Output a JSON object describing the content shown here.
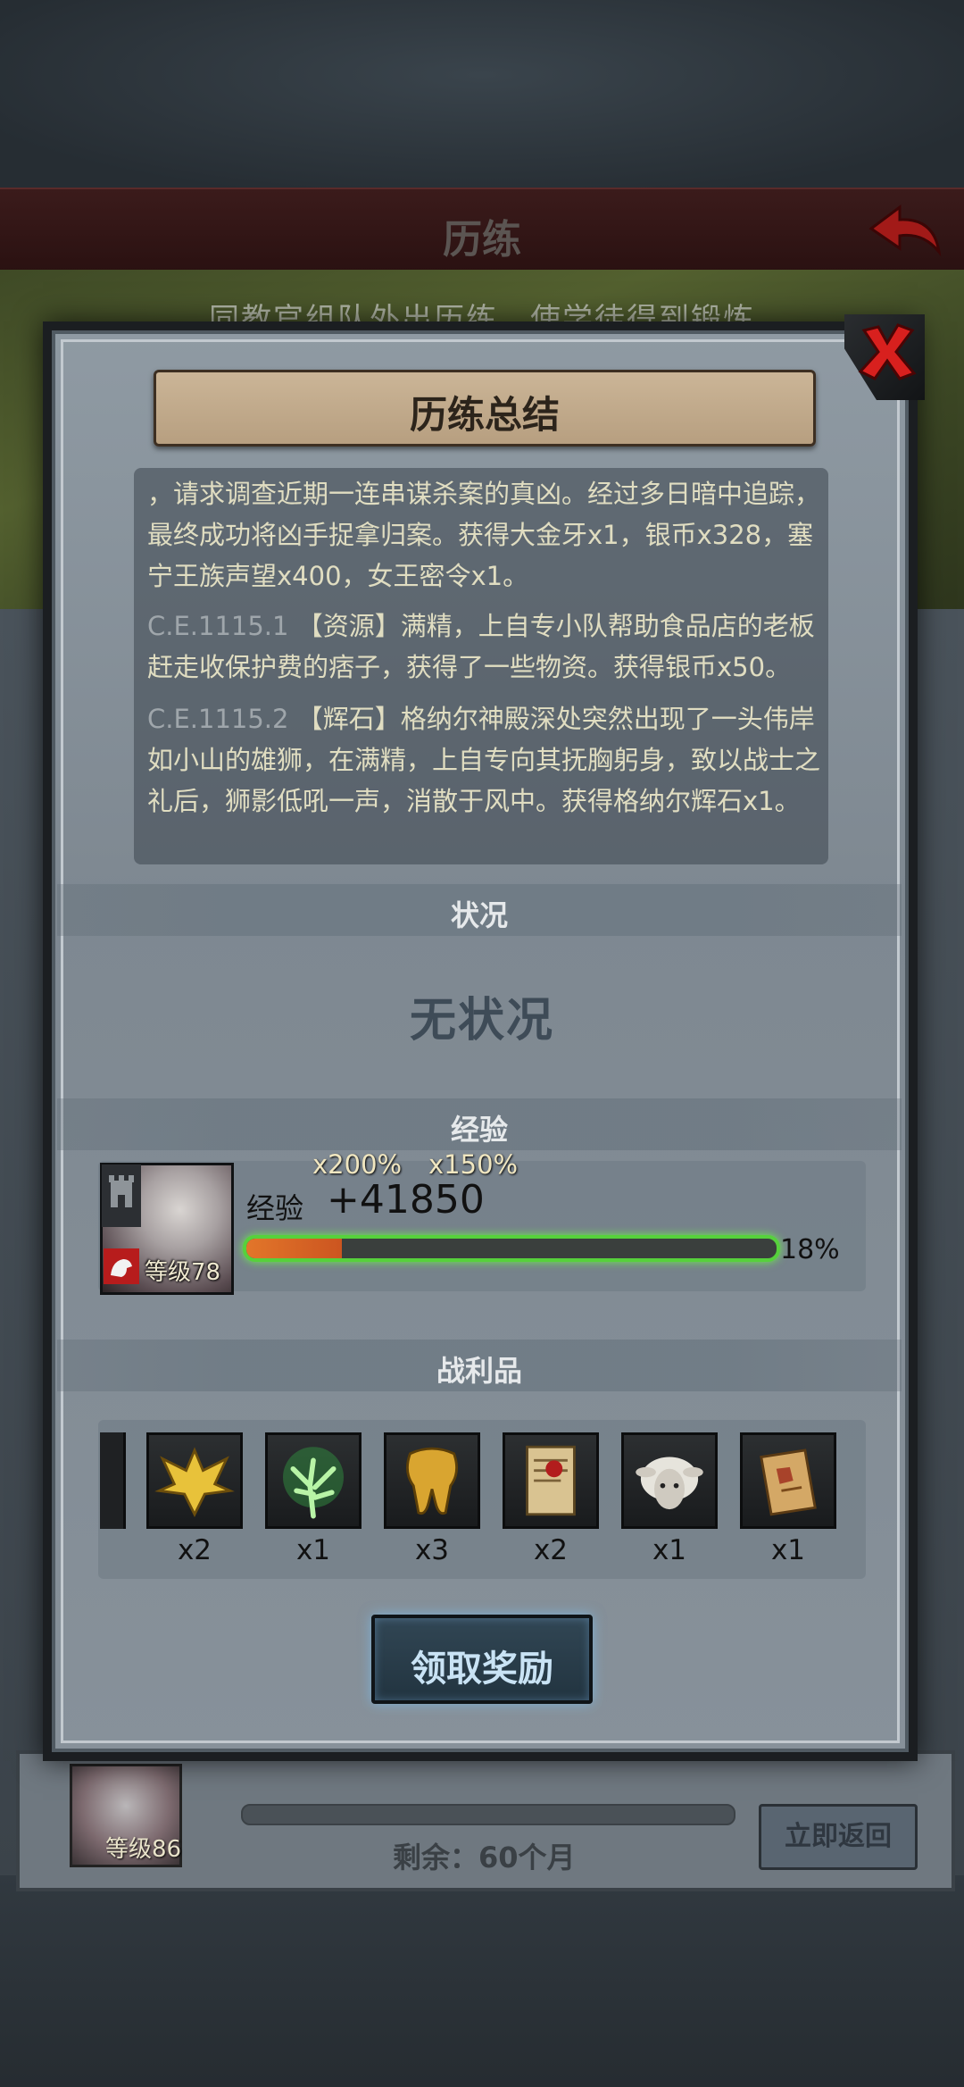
{
  "background": {
    "header_title": "历练",
    "subtitle": "同教官组队外出历练，使学徒得到锻炼",
    "footer": {
      "level": "等级86",
      "remaining": "剩余：60个月",
      "return_button": "立即返回"
    }
  },
  "dialog": {
    "title": "历练总结",
    "log": [
      {
        "date": "",
        "text": "，请求调查近期一连串谋杀案的真凶。经过多日暗中追踪，最终成功将凶手捉拿归案。获得大金牙x1，银币x328，塞宁王族声望x400，女王密令x1。"
      },
      {
        "date": "C.E.1115.1",
        "text": "【资源】满精，上自专小队帮助食品店的老板赶走收保护费的痞子，获得了一些物资。获得银币x50。"
      },
      {
        "date": "C.E.1115.2",
        "text": "【辉石】格纳尔神殿深处突然出现了一头伟岸如小山的雄狮，在满精，上自专向其抚胸躬身，致以战士之礼后，狮影低吼一声，消散于风中。获得格纳尔辉石x1。"
      }
    ],
    "status_header": "状况",
    "status_text": "无状况",
    "exp_header": "经验",
    "exp": {
      "multiplier_1": "x200%",
      "multiplier_2": "x150%",
      "label": "经验",
      "value": "+41850",
      "percent_text": "18%",
      "progress": 0.18,
      "hero_level": "等级78"
    },
    "loot_header": "战利品",
    "loot": [
      {
        "icon": "gold-crest-icon",
        "count": "x2"
      },
      {
        "icon": "green-tree-icon",
        "count": "x1"
      },
      {
        "icon": "gold-tooth-icon",
        "count": "x3"
      },
      {
        "icon": "sealed-scroll-icon",
        "count": "x2"
      },
      {
        "icon": "sheep-icon",
        "count": "x1"
      },
      {
        "icon": "map-scroll-icon",
        "count": "x1"
      }
    ],
    "claim_button": "领取奖励"
  },
  "colors": {
    "exp_bar_border": "#56d13c",
    "exp_bar_fill": "#e2762a",
    "log_text": "#e0ddc1",
    "close_red": "#d8201e"
  }
}
